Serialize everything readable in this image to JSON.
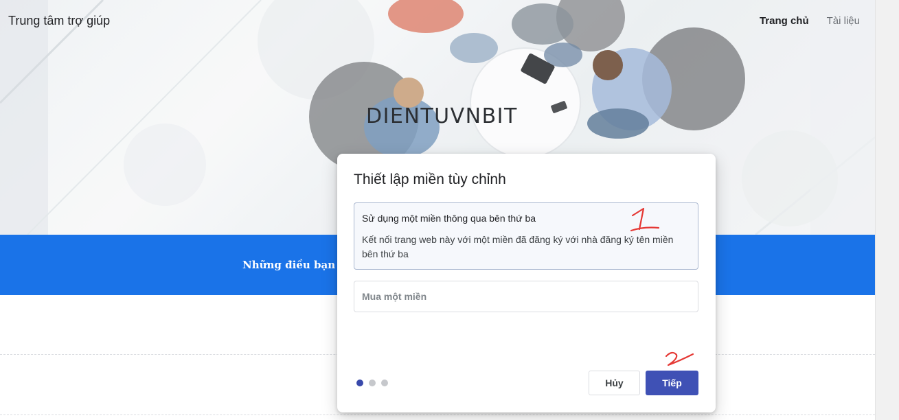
{
  "header": {
    "site_title": "Trung tâm trợ giúp",
    "nav": {
      "home": "Trang chủ",
      "docs": "Tài liệu"
    }
  },
  "hero": {
    "brand": "DIENTUVNBIT"
  },
  "band": {
    "text": "Những điều bạn cầ"
  },
  "dialog": {
    "title": "Thiết lập miền tùy chỉnh",
    "options": [
      {
        "title": "Sử dụng một miền thông qua bên thứ ba",
        "description": "Kết nối trang web này với một miền đã đăng ký với nhà đăng ký tên miền bên thứ ba",
        "selected": true
      },
      {
        "title": "Mua một miền",
        "selected": false
      }
    ],
    "steps": {
      "total": 3,
      "current": 1
    },
    "buttons": {
      "cancel": "Hủy",
      "next": "Tiếp"
    }
  },
  "annotations": {
    "mark_1": "1",
    "mark_2": "2",
    "color": "#e53935"
  },
  "colors": {
    "primary_band": "#1a73e8",
    "primary_button": "#3f51b5",
    "active_dot": "#3949ab"
  }
}
